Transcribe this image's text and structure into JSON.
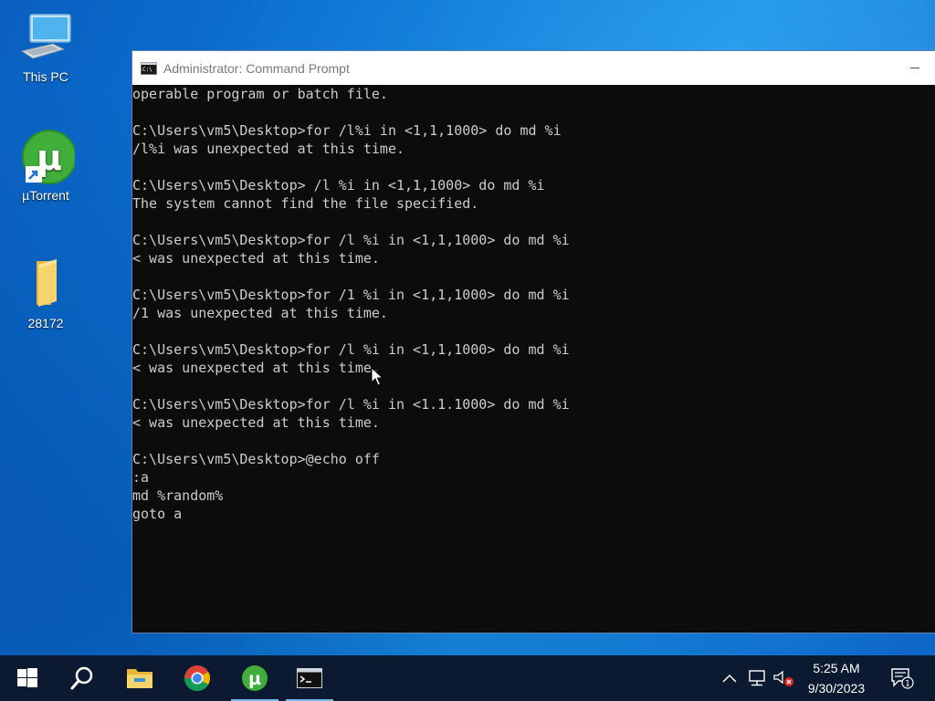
{
  "desktop": {
    "icons": [
      {
        "label": "This PC",
        "icon": "this-pc-icon"
      },
      {
        "label": "µTorrent",
        "icon": "utorrent-icon"
      },
      {
        "label": "28172",
        "icon": "folder-icon"
      }
    ]
  },
  "window": {
    "title": "Administrator: Command Prompt",
    "icon": "cmd-icon",
    "lines": [
      "operable program or batch file.",
      "",
      "C:\\Users\\vm5\\Desktop>for /l%i in <1,1,1000> do md %i",
      "/l%i was unexpected at this time.",
      "",
      "C:\\Users\\vm5\\Desktop> /l %i in <1,1,1000> do md %i",
      "The system cannot find the file specified.",
      "",
      "C:\\Users\\vm5\\Desktop>for /l %i in <1,1,1000> do md %i",
      "< was unexpected at this time.",
      "",
      "C:\\Users\\vm5\\Desktop>for /1 %i in <1,1,1000> do md %i",
      "/1 was unexpected at this time.",
      "",
      "C:\\Users\\vm5\\Desktop>for /l %i in <1,1,1000> do md %i",
      "< was unexpected at this time.",
      "",
      "C:\\Users\\vm5\\Desktop>for /l %i in <1.1.1000> do md %i",
      "< was unexpected at this time.",
      "",
      "C:\\Users\\vm5\\Desktop>@echo off",
      ":a",
      "md %random%",
      "goto a"
    ]
  },
  "taskbar": {
    "items": [
      "start-icon",
      "search-icon",
      "file-explorer-icon",
      "chrome-icon",
      "utorrent-icon",
      "cmd-icon"
    ],
    "tray": {
      "icons": [
        "chevron-up-icon",
        "network-icon",
        "volume-muted-icon"
      ],
      "time": "5:25 AM",
      "date": "9/30/2023",
      "notification_count": "1"
    }
  },
  "colors": {
    "console_bg": "#0c0c0c",
    "console_text": "#cccccc",
    "taskbar_bg": "#0b1a30",
    "accent": "#76b9ed"
  }
}
